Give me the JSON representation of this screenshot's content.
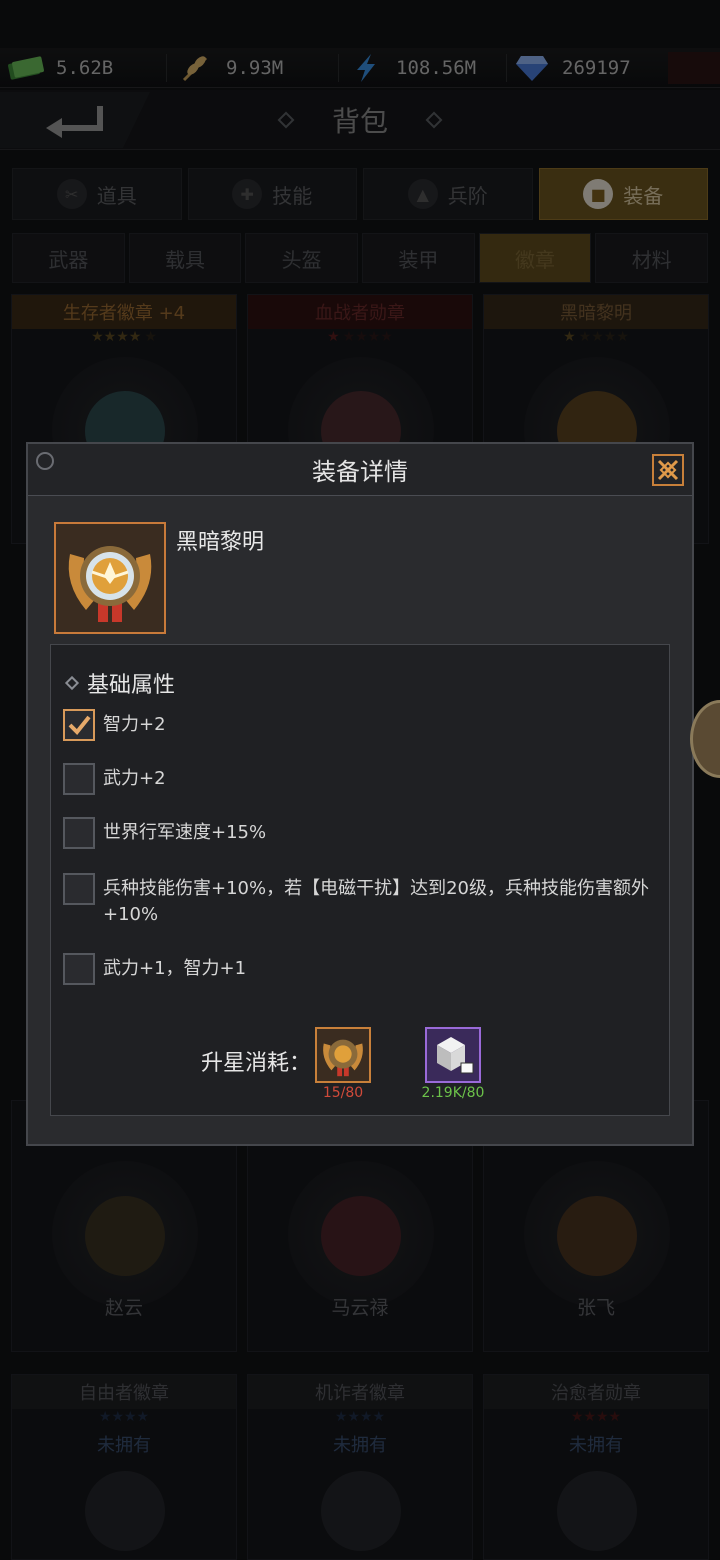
{
  "resources": [
    {
      "icon": "cash-icon",
      "value": "5.62B"
    },
    {
      "icon": "wheat-icon",
      "value": "9.93M"
    },
    {
      "icon": "lightning-icon",
      "value": "108.56M"
    },
    {
      "icon": "diamond-icon",
      "value": "269197"
    }
  ],
  "header": {
    "title": "背包"
  },
  "tabs": [
    {
      "label": "道具",
      "icon": "tools-icon"
    },
    {
      "label": "技能",
      "icon": "skill-icon"
    },
    {
      "label": "兵阶",
      "icon": "rank-icon"
    },
    {
      "label": "装备",
      "icon": "armor-icon",
      "active": true
    }
  ],
  "subtabs": [
    {
      "label": "武器"
    },
    {
      "label": "载具"
    },
    {
      "label": "头盔"
    },
    {
      "label": "装甲"
    },
    {
      "label": "徽章",
      "active": true
    },
    {
      "label": "材料"
    }
  ],
  "cards_top": [
    {
      "name": "生存者徽章 +4",
      "color": "#c3803a",
      "stars": 4
    },
    {
      "name": "血战者勋章",
      "color": "#a33232",
      "stars": 1
    },
    {
      "name": "黑暗黎明",
      "color": "#b07a45",
      "stars": 1
    }
  ],
  "cards_mid": [
    {
      "hero": "赵云"
    },
    {
      "hero": "马云禄"
    },
    {
      "hero": "张飞"
    }
  ],
  "cards_bottom": [
    {
      "name": "自由者徽章",
      "status": "未拥有"
    },
    {
      "name": "机诈者徽章",
      "status": "未拥有"
    },
    {
      "name": "治愈者勋章",
      "status": "未拥有"
    }
  ],
  "modal": {
    "title": "装备详情",
    "item_name": "黑暗黎明",
    "section_title": "基础属性",
    "attributes": [
      {
        "text": "智力+2",
        "checked": true
      },
      {
        "text": "武力+2",
        "checked": false
      },
      {
        "text": "世界行军速度+15%",
        "checked": false
      },
      {
        "text": "兵种技能伤害+10%，若【电磁干扰】达到20级，兵种技能伤害额外+10%",
        "checked": false
      },
      {
        "text": "武力+1，智力+1",
        "checked": false
      }
    ],
    "cost_label": "升星消耗：",
    "costs": [
      {
        "icon": "dark-dawn-medal-icon",
        "value": "15/80",
        "color": "#d04a3a"
      },
      {
        "icon": "cube-material-icon",
        "value": "2.19K/80",
        "color": "#6cc24a"
      }
    ]
  }
}
